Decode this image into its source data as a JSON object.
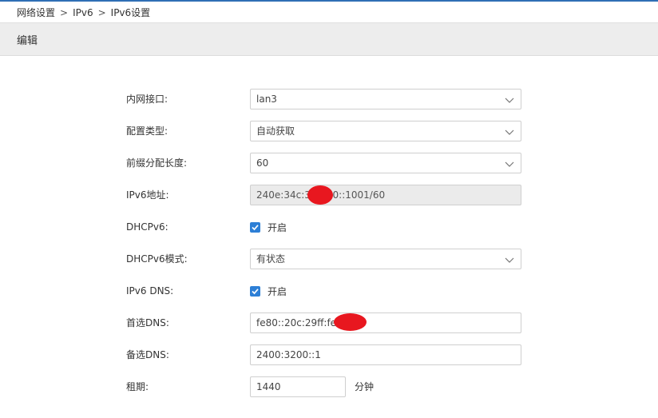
{
  "breadcrumb": {
    "items": [
      "网络设置",
      "IPv6",
      "IPv6设置"
    ],
    "separator": ">"
  },
  "section": {
    "title": "编辑"
  },
  "form": {
    "lan_interface": {
      "label": "内网接口:",
      "value": "lan3"
    },
    "config_type": {
      "label": "配置类型:",
      "value": "自动获取"
    },
    "prefix_length": {
      "label": "前缀分配长度:",
      "value": "60"
    },
    "ipv6_address": {
      "label": "IPv6地址:",
      "value_start": "240e:34c:35",
      "value_end": "0::1001/60"
    },
    "dhcpv6": {
      "label": "DHCPv6:",
      "checkbox_label": "开启",
      "checked": true
    },
    "dhcpv6_mode": {
      "label": "DHCPv6模式:",
      "value": "有状态"
    },
    "ipv6_dns": {
      "label": "IPv6 DNS:",
      "checkbox_label": "开启",
      "checked": true
    },
    "primary_dns": {
      "label": "首选DNS:",
      "value": "fe80::20c:29ff:fee"
    },
    "secondary_dns": {
      "label": "备选DNS:",
      "value": "2400:3200::1"
    },
    "lease": {
      "label": "租期:",
      "value": "1440",
      "unit": "分钟"
    }
  },
  "icons": {
    "dropdown": "chevron-down-icon",
    "checkbox": "checkbox-checked-icon"
  },
  "colors": {
    "accent_blue": "#2d7fd6",
    "top_line": "#2f6fb5",
    "section_bar": "#ededed",
    "readonly_field": "#ebebeb",
    "redaction": "#e8171f"
  }
}
